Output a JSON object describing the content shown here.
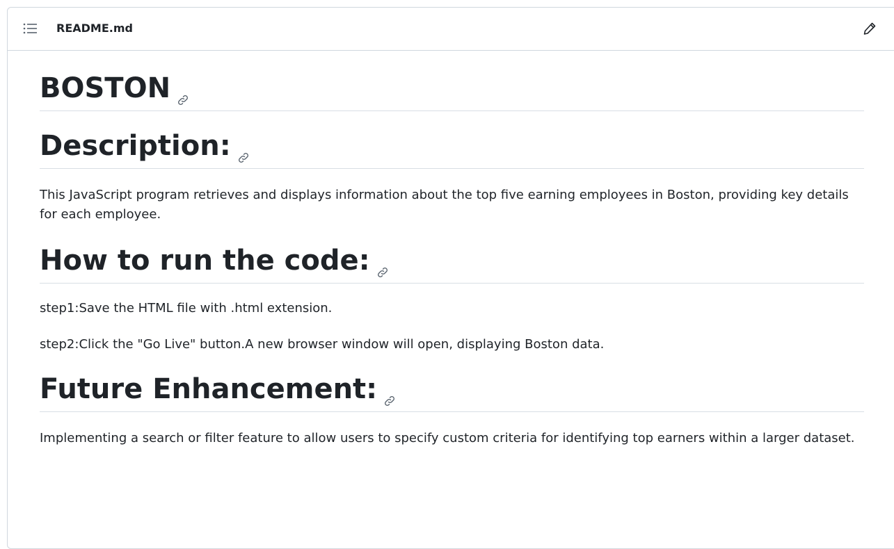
{
  "header": {
    "file_name": "README.md",
    "toc_icon": "list-unordered-icon",
    "edit_icon": "pencil-icon"
  },
  "readme": {
    "title": "BOSTON",
    "sections": [
      {
        "heading": "Description:",
        "paragraphs": [
          "This JavaScript program retrieves and displays information about the top five earning employees in Boston, providing key details for each employee."
        ]
      },
      {
        "heading": "How to run the code:",
        "paragraphs": [
          "step1:Save the HTML file with .html extension.",
          "step2:Click the \"Go Live\" button.A new browser window will open, displaying Boston data."
        ]
      },
      {
        "heading": "Future Enhancement:",
        "paragraphs": [
          "Implementing a search or filter feature to allow users to specify custom criteria for identifying top earners within a larger dataset."
        ]
      }
    ],
    "anchor_icon": "link-icon"
  },
  "colors": {
    "text": "#1f2328",
    "border": "#d0d7de",
    "icon": "#59636e"
  }
}
